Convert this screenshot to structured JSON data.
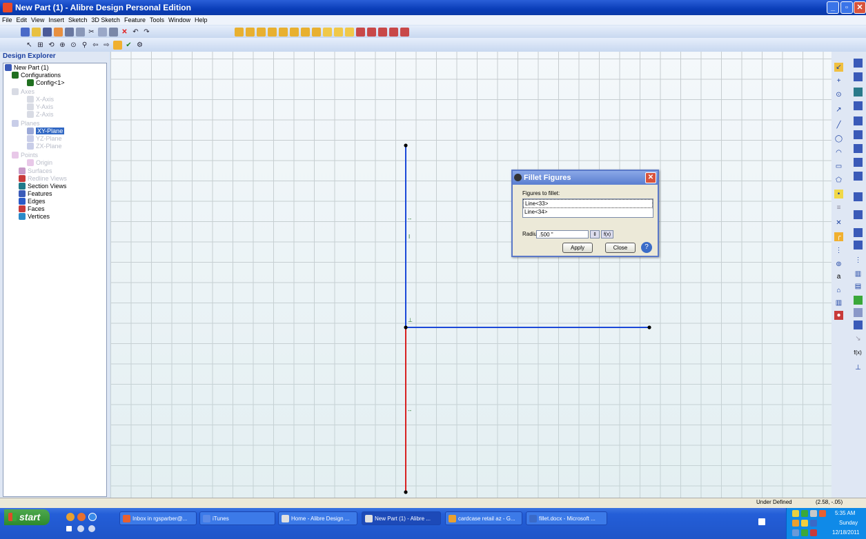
{
  "window": {
    "title": "New Part (1) - Alibre Design Personal Edition"
  },
  "menu": [
    "File",
    "Edit",
    "View",
    "Insert",
    "Sketch",
    "3D Sketch",
    "Feature",
    "Tools",
    "Window",
    "Help"
  ],
  "explorer": {
    "header": "Design Explorer",
    "items": [
      {
        "label": "New Part (1)",
        "state": "normal"
      },
      {
        "label": "Configurations",
        "state": "normal"
      },
      {
        "label": "Config<1>",
        "state": "normal"
      },
      {
        "label": "Axes",
        "state": "dim"
      },
      {
        "label": "X-Axis",
        "state": "dim"
      },
      {
        "label": "Y-Axis",
        "state": "dim"
      },
      {
        "label": "Z-Axis",
        "state": "dim"
      },
      {
        "label": "Planes",
        "state": "dim"
      },
      {
        "label": "XY-Plane",
        "state": "selected"
      },
      {
        "label": "YZ-Plane",
        "state": "dim"
      },
      {
        "label": "ZX-Plane",
        "state": "dim"
      },
      {
        "label": "Points",
        "state": "dim"
      },
      {
        "label": "Origin",
        "state": "dim"
      },
      {
        "label": "Surfaces",
        "state": "dim"
      },
      {
        "label": "Redline Views",
        "state": "dim"
      },
      {
        "label": "Section Views",
        "state": "normal"
      },
      {
        "label": "Features",
        "state": "normal"
      },
      {
        "label": "Edges",
        "state": "normal"
      },
      {
        "label": "Faces",
        "state": "normal"
      },
      {
        "label": "Vertices",
        "state": "normal"
      }
    ]
  },
  "dialog": {
    "title": "Fillet Figures",
    "figures_label": "Figures to fillet:",
    "figures": [
      "Line<33>",
      "Line<34>"
    ],
    "radius_label": "Radius:",
    "radius_value": ".500 \"",
    "fx_label": "f(x)",
    "apply_label": "Apply",
    "close_label": "Close"
  },
  "rightbar": {
    "fx_label": "f(x)"
  },
  "status": {
    "state": "Under Defined",
    "coords": "(2.58, -.05)"
  },
  "taskbar": {
    "start_label": "start",
    "tasks": [
      {
        "label": "Inbox in rgsparber@...",
        "active": false
      },
      {
        "label": "iTunes",
        "active": false
      },
      {
        "label": "Home - Alibre Design ...",
        "active": false
      },
      {
        "label": "New Part (1) - Alibre ...",
        "active": true
      },
      {
        "label": "cardcase retail az - G...",
        "active": false
      },
      {
        "label": "fillet.docx - Microsoft ...",
        "active": false
      }
    ],
    "clock_time": "5:35 AM",
    "clock_day": "Sunday",
    "clock_date": "12/18/2011"
  }
}
